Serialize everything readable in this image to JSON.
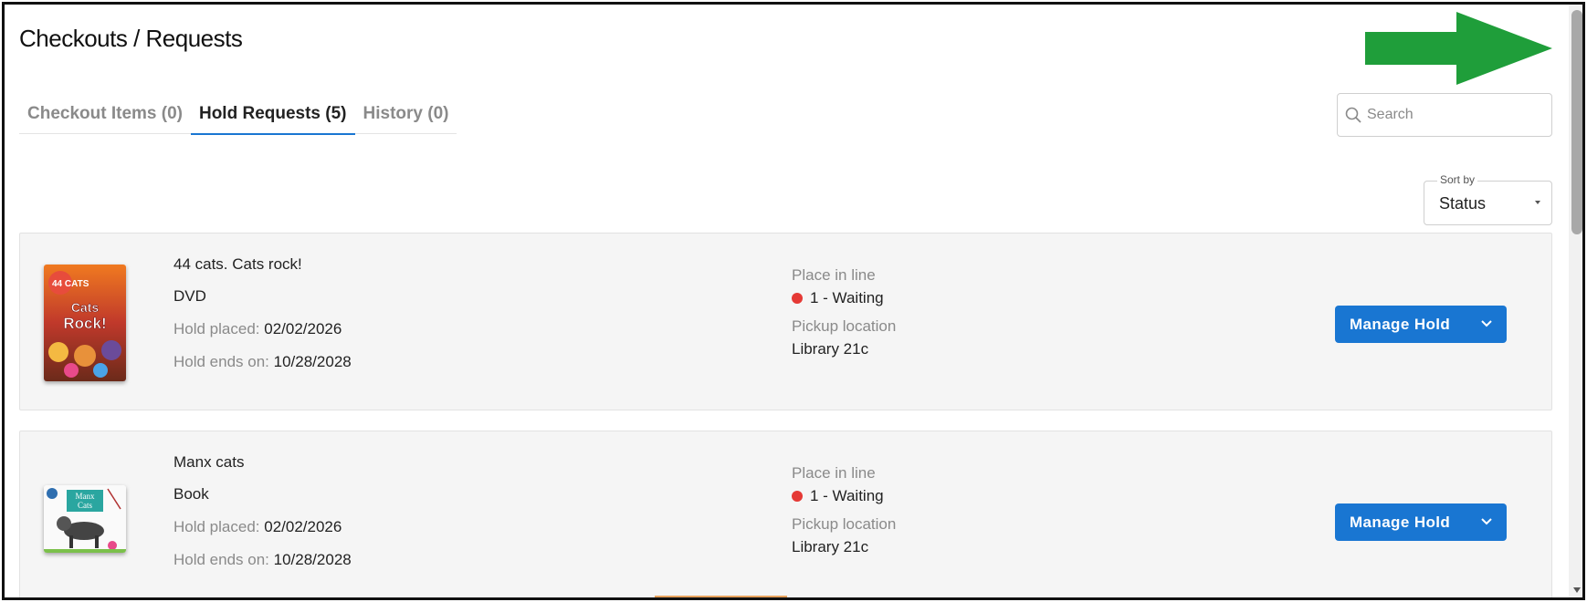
{
  "page": {
    "title": "Checkouts / Requests"
  },
  "tabs": [
    {
      "label": "Checkout Items (0)",
      "active": false
    },
    {
      "label": "Hold Requests (5)",
      "active": true
    },
    {
      "label": "History (0)",
      "active": false
    }
  ],
  "search": {
    "placeholder": "Search",
    "icon": "search-icon"
  },
  "sort": {
    "label": "Sort by",
    "value": "Status"
  },
  "holds": [
    {
      "title": "44 cats. Cats rock!",
      "format": "DVD",
      "hold_placed_label": "Hold placed:",
      "hold_placed": "02/02/2026",
      "hold_ends_label": "Hold ends on:",
      "hold_ends": "10/28/2028",
      "place_label": "Place in line",
      "place_value": "1 - Waiting",
      "pickup_label": "Pickup location",
      "pickup_value": "Library 21c",
      "action_label": "Manage Hold",
      "cover_text": "Cats Rock!",
      "cover_logo": "44 CATS"
    },
    {
      "title": "Manx cats",
      "format": "Book",
      "hold_placed_label": "Hold placed:",
      "hold_placed": "02/02/2026",
      "hold_ends_label": "Hold ends on:",
      "hold_ends": "10/28/2028",
      "place_label": "Place in line",
      "place_value": "1 - Waiting",
      "pickup_label": "Pickup location",
      "pickup_value": "Library 21c",
      "action_label": "Manage Hold",
      "cover_text": "Manx Cats"
    }
  ],
  "colors": {
    "accent": "#1976d2",
    "status_dot": "#e53935",
    "annotation_arrow": "#1f9e3a"
  }
}
